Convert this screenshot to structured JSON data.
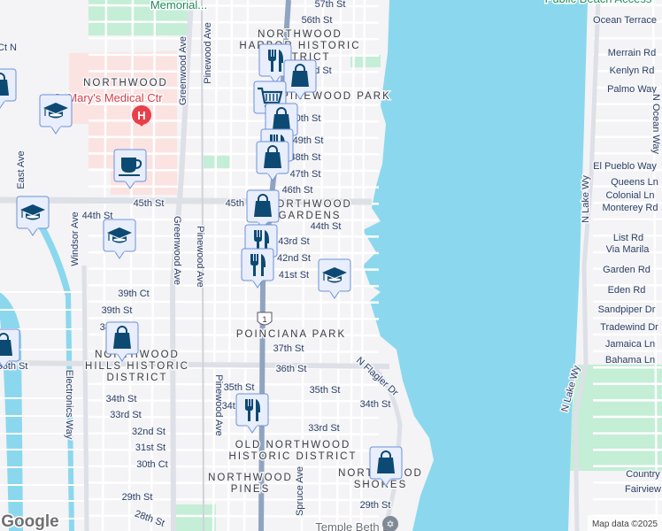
{
  "colors": {
    "water": "#8bd8ee",
    "park": "#c4eed6",
    "hospital": "#fbe3e2",
    "road": "#ffffff",
    "major_road": "#dfe1e6",
    "highway": "#8fa4c0",
    "marker_fill": "#e8eefc",
    "marker_stroke": "#6d92d8",
    "icon": "#0d4a73",
    "hospital_pin": "#e8404b"
  },
  "streets": [
    "57th St",
    "56th St",
    "53rd St",
    "50th St",
    "49th St",
    "48th St",
    "47th St",
    "46th St",
    "45th St",
    "45th St",
    "44th St",
    "43rd St",
    "42nd St",
    "41st St",
    "44th St",
    "Ct N",
    "East Ave",
    "Windsor Ave",
    "Greenwood Ave",
    "Pinewood Ave",
    "Greenwood Ave",
    "Pinewood Ave",
    "39th Ct",
    "39th St",
    "38th St",
    "36th St",
    "Electronics Way",
    "34th St",
    "33rd St",
    "32nd St",
    "31st St",
    "30th Ct",
    "29th St",
    "28th St",
    "37th St",
    "36th St",
    "35th St",
    "34th St",
    "Pinewood Ave",
    "N Flagler Dr",
    "35th St",
    "34th St",
    "33rd St",
    "Spruce Ave",
    "29th St",
    "Ocean Terrace",
    "Merrain Rd",
    "Kenlyn Rd",
    "Palmo Way",
    "N Ocean Way",
    "El Pueblo Way",
    "Queens Ln",
    "Colonial Ln",
    "Monterey Rd",
    "N Lake Wy",
    "List Rd",
    "Via Marila",
    "Garden Rd",
    "Eden Rd",
    "Sandpiper Dr",
    "Tradewind Dr",
    "Jamaica Ln",
    "Bahama Ln",
    "N Lake Wy",
    "Country C",
    "Fairview R"
  ],
  "neighborhoods": [
    [
      "NORTHWOOD",
      "HARBOR HISTORIC",
      "DISTRICT"
    ],
    [
      "NORTHWOOD"
    ],
    [
      "PINEWOOD PARK"
    ],
    [
      "NORTHWOOD",
      "GARDENS"
    ],
    [
      "POINCIANA PARK"
    ],
    [
      "NORTHWOOD",
      "HILLS HISTORIC",
      "DISTRICT"
    ],
    [
      "OLD NORTHWOOD",
      "HISTORIC DISTRICT"
    ],
    [
      "NORTHWOOD",
      "PINES"
    ],
    [
      "NORTHWOOD",
      "SHORES"
    ]
  ],
  "places": [
    "Memorial...",
    "St Mary's Medical Ctr",
    "Public Beach Access",
    "Temple Beth El"
  ],
  "route_shield": "1",
  "markers": [
    {
      "type": "shopping"
    },
    {
      "type": "school"
    },
    {
      "type": "cafe"
    },
    {
      "type": "school"
    },
    {
      "type": "school"
    },
    {
      "type": "restaurant"
    },
    {
      "type": "shopping"
    },
    {
      "type": "grocery"
    },
    {
      "type": "shopping"
    },
    {
      "type": "restaurant"
    },
    {
      "type": "shopping"
    },
    {
      "type": "shopping"
    },
    {
      "type": "restaurant"
    },
    {
      "type": "restaurant"
    },
    {
      "type": "school"
    },
    {
      "type": "shopping"
    },
    {
      "type": "shopping"
    },
    {
      "type": "restaurant"
    },
    {
      "type": "shopping"
    }
  ],
  "hospital_icon": "H",
  "logo": "Google",
  "attribution": "Map data ©2025"
}
